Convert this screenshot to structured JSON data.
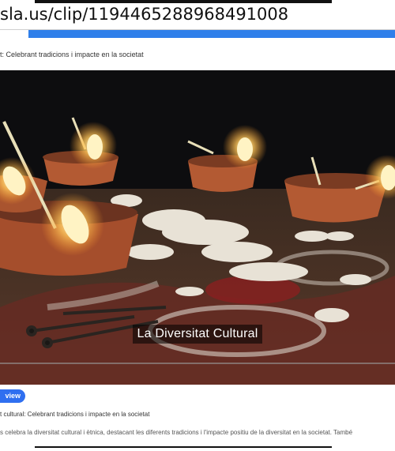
{
  "browser": {
    "url": "sla.us/clip/1194465288968491008"
  },
  "clip": {
    "title": "t: Celebrant tradicions i impacte en la societat",
    "video_caption": "La Diversitat Cultural",
    "view_button": "view",
    "title_bottom": "t cultural: Celebrant tradicions i impacte en la societat",
    "description": "s celebra la diversitat cultural i ètnica, destacant les diferents tradicions i l'impacte positiu de la diversitat en la societat. També"
  },
  "colors": {
    "accent": "#2f7fea",
    "button": "#2f6ff0"
  }
}
